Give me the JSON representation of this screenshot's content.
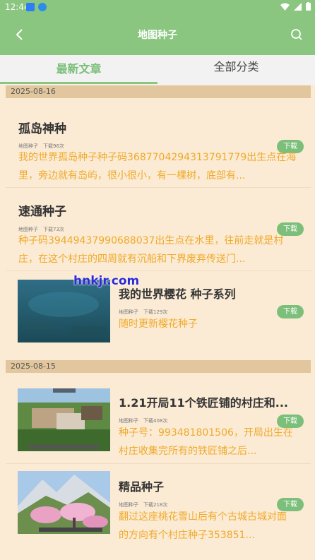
{
  "status_bar": {
    "time": "12:44"
  },
  "app_bar": {
    "title": "地图种子"
  },
  "tabs": [
    {
      "label": "最新文章"
    },
    {
      "label": "全部分类"
    }
  ],
  "download_label": "下载",
  "category": "地图种子",
  "groups": [
    {
      "date": "2025-08-16",
      "articles": [
        {
          "title": "孤岛神种",
          "downloads": "下载96次",
          "desc": "我的世界孤岛种子种子码3687704294313791779出生点在海里，旁边就有岛屿，很小很小，有一棵树，底部有..."
        },
        {
          "title": "速通种子",
          "downloads": "下载73次",
          "desc": "种子码39449437990688037出生点在水里，往前走就是村庄，在这个村庄的四周就有沉船和下界废弃传送门..."
        },
        {
          "title": "我的世界樱花 种子系列",
          "downloads": "下载129次",
          "desc": "随时更新樱花种子"
        }
      ]
    },
    {
      "date": "2025-08-15",
      "articles": [
        {
          "title": "1.21开局11个铁匠铺的村庄和...",
          "downloads": "下载408次",
          "desc": "种子号：993481801506，开局出生在村庄收集完所有的铁匠铺之后..."
        },
        {
          "title": "精品种子",
          "downloads": "下载218次",
          "desc": "翻过这座桃花雪山后有个古城古城对面的方向有个村庄种子353851..."
        }
      ]
    }
  ],
  "watermark": "hnkjr.com"
}
